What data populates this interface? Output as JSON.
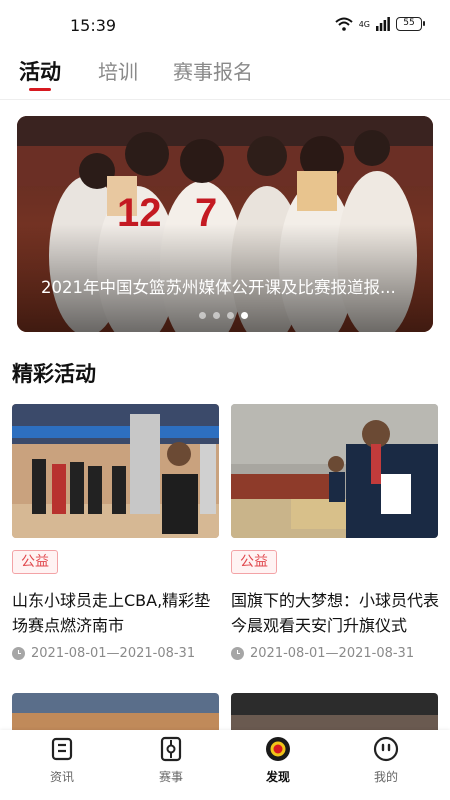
{
  "status_bar": {
    "time": "15:39",
    "network": "4G",
    "battery": "55"
  },
  "tabs": [
    {
      "label": "活动",
      "active": true
    },
    {
      "label": "培训",
      "active": false
    },
    {
      "label": "赛事报名",
      "active": false
    }
  ],
  "banner": {
    "caption": "2021年中国女篮苏州媒体公开课及比赛报道报...",
    "dots": 4,
    "active_dot": 4
  },
  "section": {
    "title": "精彩活动"
  },
  "activities": [
    {
      "tag": "公益",
      "title": "山东小球员走上CBA,精彩垫场赛点燃济南市",
      "date": "2021-08-01—2021-08-31"
    },
    {
      "tag": "公益",
      "title": "国旗下的大梦想：小球员代表今晨观看天安门升旗仪式",
      "date": "2021-08-01—2021-08-31"
    }
  ],
  "bottom_nav": [
    {
      "label": "资讯",
      "icon": "news-icon",
      "active": false
    },
    {
      "label": "赛事",
      "icon": "match-icon",
      "active": false
    },
    {
      "label": "发现",
      "icon": "discover-icon",
      "active": true
    },
    {
      "label": "我的",
      "icon": "profile-icon",
      "active": false
    }
  ],
  "colors": {
    "accent": "#d71920",
    "tag_text": "#e0474c",
    "tag_bg": "#fff3f3"
  }
}
